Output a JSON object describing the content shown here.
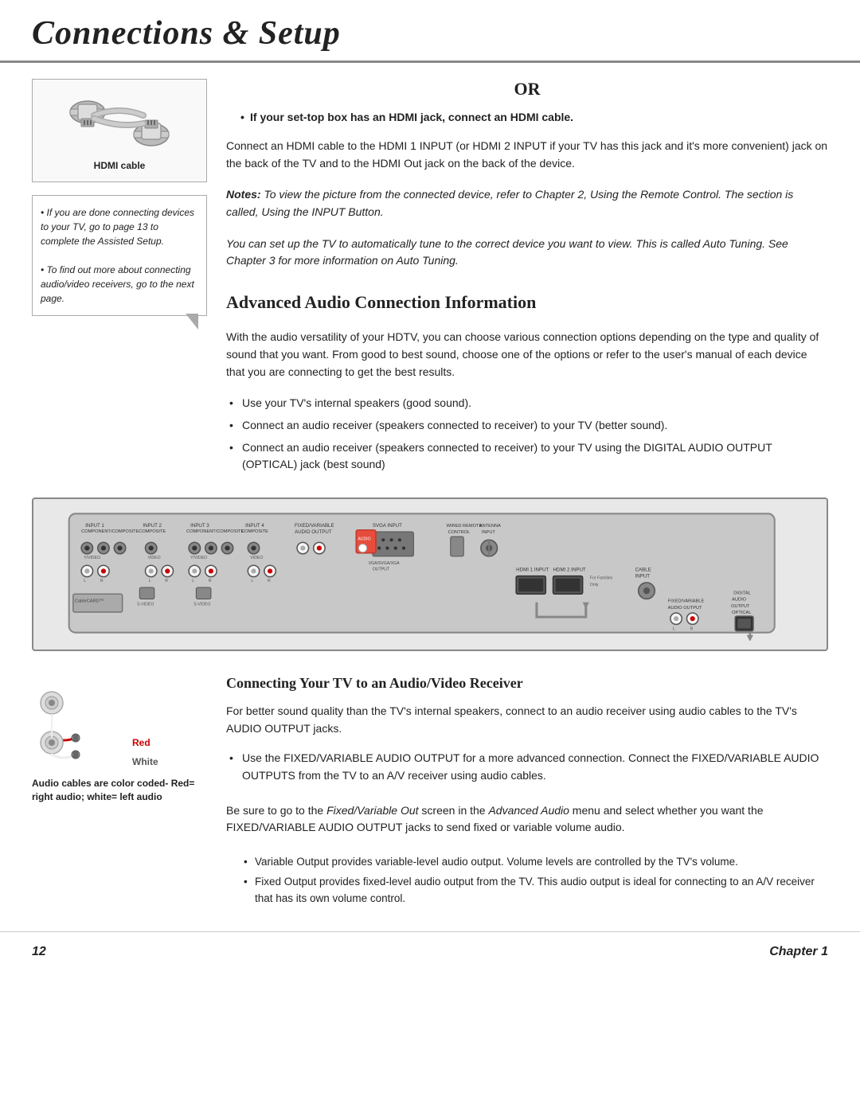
{
  "header": {
    "title": "Connections & Setup"
  },
  "left_sidebar": {
    "hdmi_cable_label": "HDMI cable",
    "note_lines": [
      "• If you are done connecting devices to your TV, go to page 13 to complete the Assisted Setup.",
      "• To find out more about connecting audio/video receivers, go to the next page."
    ]
  },
  "right_content": {
    "or_heading": "OR",
    "bullet_bold": "If your set-top box has an HDMI jack, connect an HDMI cable.",
    "para1": "Connect an HDMI cable to the HDMI 1 INPUT (or HDMI 2 INPUT if  your TV has this jack and it's more convenient) jack on the back of the TV and to the HDMI Out jack on the back of the device.",
    "italic_note1_bold": "Notes:",
    "italic_note1": " To view the picture from the connected device, refer to Chapter 2, Using the Remote Control. The section is called, Using the INPUT Button.",
    "italic_note2": "You can set up the TV to automatically tune to the correct device you want to view. This is called Auto Tuning. See Chapter 3 for more information on Auto Tuning.",
    "section_heading": "Advanced Audio Connection Information",
    "body_para": "With the audio versatility of your HDTV, you can choose various connection options depending on the type and quality of  sound that you want. From good to best sound, choose one of  the options or refer to the user's manual of  each device that you are connecting to get the best results.",
    "bullets": [
      "Use your TV's internal speakers (good sound).",
      "Connect an audio receiver (speakers connected to receiver) to your TV (better sound).",
      "Connect an audio receiver (speakers connected to receiver) to your TV using the DIGITAL AUDIO OUTPUT (OPTICAL) jack (best sound)"
    ]
  },
  "bottom_section": {
    "audio_sidebar": {
      "red_label": "Red",
      "white_label": "White",
      "caption_bold": "Audio cables are color coded- Red= right audio; white= left audio"
    },
    "right_content": {
      "sub_heading": "Connecting Your TV to an Audio/Video Receiver",
      "para1": "For better sound quality than the TV's internal speakers, connect to an audio receiver using audio cables to the TV's AUDIO OUTPUT jacks.",
      "bullets": [
        "Use the FIXED/VARIABLE AUDIO OUTPUT for a more advanced connection. Connect the FIXED/VARIABLE AUDIO OUTPUTS from the TV to an A/V receiver using audio cables."
      ],
      "para2_part1": "Be sure to go to the ",
      "para2_italic": "Fixed/Variable Out",
      "para2_part2": " screen in the ",
      "para2_italic2": "Advanced Audio",
      "para2_part3": " menu and select whether you want the FIXED/VARIABLE AUDIO OUTPUT jacks to send fixed or variable volume audio.",
      "nested_bullets": [
        "Variable Output provides variable-level audio output. Volume levels are controlled by the TV's volume.",
        "Fixed Output provides fixed-level audio output from the TV. This audio output is ideal for connecting to an A/V receiver that has its own volume control."
      ]
    }
  },
  "footer": {
    "page_number": "12",
    "chapter_label": "Chapter 1"
  }
}
